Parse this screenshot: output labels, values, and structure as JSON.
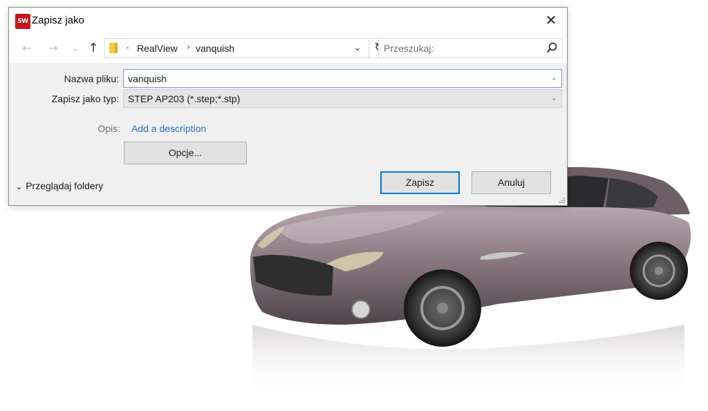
{
  "dialog": {
    "title": "Zapisz jako",
    "app_icon_text": "SW",
    "close_glyph": "✕"
  },
  "navbar": {
    "back_glyph": "←",
    "forward_glyph": "→",
    "recent_glyph": "⌄",
    "up_glyph": "↑",
    "breadcrumb": [
      "RealView",
      "vanquish"
    ],
    "breadcrumb_sep": "›",
    "dropdown_glyph": "⌄",
    "refresh_glyph": "↻",
    "search_placeholder": "Przeszukaj:",
    "icons": [
      "back-arrow-icon",
      "forward-arrow-icon",
      "up-arrow-icon",
      "folder-icon",
      "refresh-icon",
      "search-icon"
    ]
  },
  "form": {
    "filename_label": "Nazwa pliku:",
    "filename_value": "vanquish",
    "type_label": "Zapisz jako typ:",
    "type_value": "STEP AP203 (*.step;*.stp)",
    "desc_label": "Opis:",
    "desc_link": "Add a description",
    "options_button": "Opcje...",
    "save_button": "Zapisz",
    "cancel_button": "Anuluj",
    "browse_toggle": "Przeglądaj foldery",
    "caret_glyph": "⌄"
  },
  "colors": {
    "accent": "#0078d7",
    "link": "#1f6fc6",
    "app_icon": "#c4161c",
    "car_body": "#8c7a82"
  }
}
